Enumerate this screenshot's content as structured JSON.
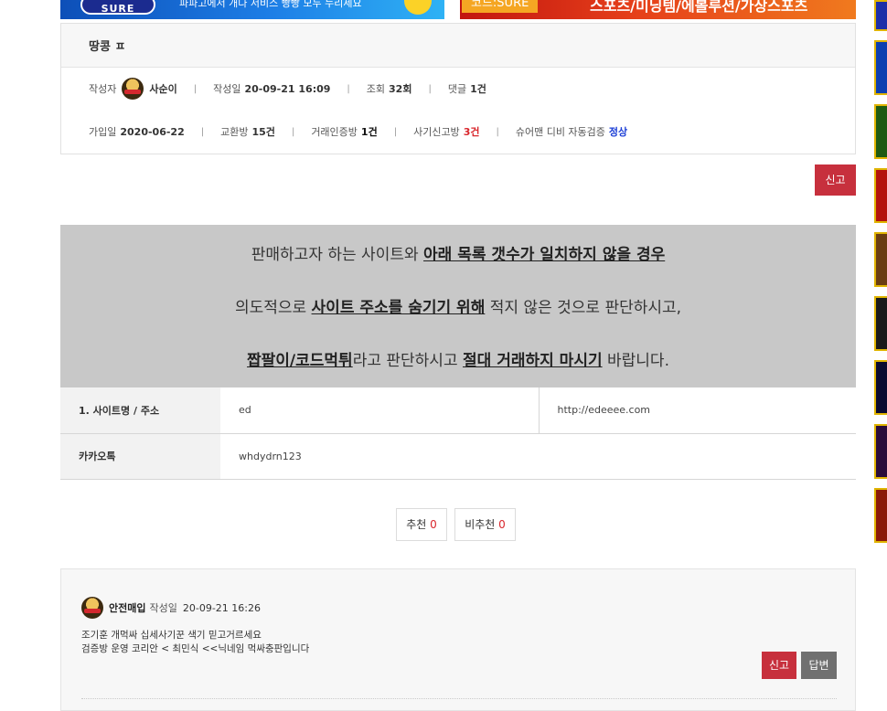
{
  "banners": {
    "left": {
      "logo": "SURE",
      "text": "파파고에서 개다 서비스 빵빵 모두 누리세요"
    },
    "right": {
      "tag": "코드:SURE",
      "text": "스포츠/미닝템/에볼루션/가상스포츠"
    }
  },
  "post": {
    "title": "땅콩 ㅍ",
    "author_label": "작성자",
    "author": "사순이",
    "date_label": "작성일",
    "date": "20-09-21 16:09",
    "views_label": "조회",
    "views": "32회",
    "comments_label": "댓글",
    "comments": "1건",
    "joined_label": "가입일",
    "joined": "2020-06-22",
    "exchange_label": "교환방",
    "exchange": "15건",
    "trade_label": "거래인증방",
    "trade": "1건",
    "fraud_label": "사기신고방",
    "fraud": "3건",
    "db_label": "슈어맨 디비 자동검증",
    "db_status": "정상",
    "report_label": "신고"
  },
  "warning": {
    "line1_pre": "판매하고자 하는 사이트와 ",
    "line1_bold": "아래 목록 갯수가 일치하지 않을 경우",
    "line2_pre": "의도적으로 ",
    "line2_bold": "사이트 주소를 숨기기 위해",
    "line2_post": " 적지 않은 것으로 판단하시고,",
    "line3_bold1": "짭팔이/코드먹튀",
    "line3_mid": "라고 판단하시고 ",
    "line3_bold2": "절대 거래하지 마시기",
    "line3_post": " 바랍니다."
  },
  "info_table": {
    "row1": {
      "label": "1. 사이트명 / 주소",
      "name": "ed",
      "url": "http://edeeee.com"
    },
    "row2": {
      "label": "카카오톡",
      "value": "whdydrn123"
    }
  },
  "votes": {
    "up_label": "추천",
    "up_count": "0",
    "down_label": "비추천",
    "down_count": "0"
  },
  "comment": {
    "author": "안전매입",
    "date_label": "작성일",
    "date": "20-09-21 16:26",
    "line1": "조기훈 개먹싸 십세사기꾼 색기 믿고거르세요",
    "line2": "검증방 운영 코리안 < 최민식 <<닉네임 먹싸충판입니다",
    "report_label": "신고",
    "reply_label": "답변"
  },
  "colors": {
    "report_red": "#c7303d",
    "warning_bg": "#c8c8c8",
    "count_red": "#d9262c",
    "status_blue": "#1c3fd6"
  }
}
